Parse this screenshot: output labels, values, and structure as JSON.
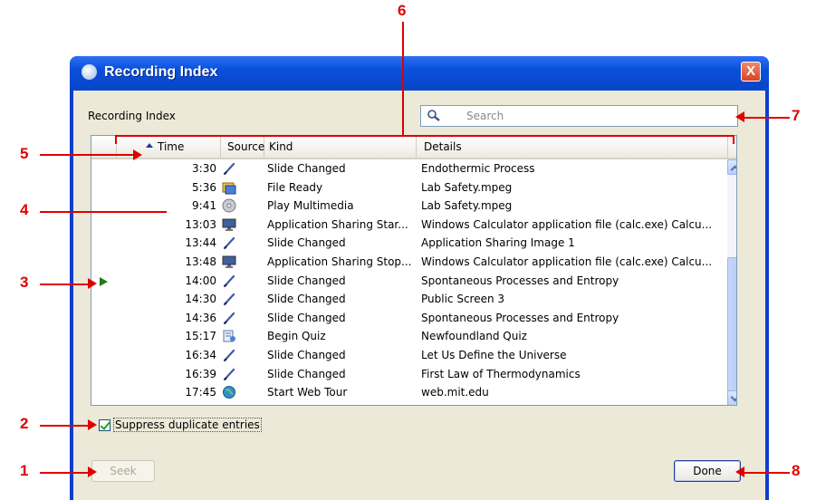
{
  "window": {
    "title": "Recording Index",
    "close_label": "X"
  },
  "index_label": "Recording Index",
  "search": {
    "placeholder": "Search"
  },
  "columns": {
    "time": "Time",
    "source": "Source",
    "kind": "Kind",
    "details": "Details"
  },
  "rows": [
    {
      "time": "3:30",
      "source": "pencil-icon",
      "kind": "Slide Changed",
      "details": "Endothermic Process"
    },
    {
      "time": "5:36",
      "source": "file-ready-icon",
      "kind": "File Ready",
      "details": "Lab Safety.mpeg"
    },
    {
      "time": "9:41",
      "source": "disc-icon",
      "kind": "Play Multimedia",
      "details": "Lab Safety.mpeg"
    },
    {
      "time": "13:03",
      "source": "monitor-icon",
      "kind": "Application Sharing Star...",
      "details": "Windows Calculator application file (calc.exe) Calcu..."
    },
    {
      "time": "13:44",
      "source": "pencil-icon",
      "kind": "Slide Changed",
      "details": "Application Sharing Image 1"
    },
    {
      "time": "13:48",
      "source": "monitor-icon",
      "kind": "Application Sharing Stop...",
      "details": "Windows Calculator application file (calc.exe) Calcu..."
    },
    {
      "time": "14:00",
      "source": "pencil-icon",
      "kind": "Slide Changed",
      "details": "Spontaneous Processes and Entropy",
      "current": true
    },
    {
      "time": "14:30",
      "source": "pencil-icon",
      "kind": "Slide Changed",
      "details": "Public Screen 3"
    },
    {
      "time": "14:36",
      "source": "pencil-icon",
      "kind": "Slide Changed",
      "details": "Spontaneous Processes and Entropy"
    },
    {
      "time": "15:17",
      "source": "quiz-icon",
      "kind": "Begin Quiz",
      "details": "Newfoundland Quiz"
    },
    {
      "time": "16:34",
      "source": "pencil-icon",
      "kind": "Slide Changed",
      "details": "Let Us Define the Universe"
    },
    {
      "time": "16:39",
      "source": "pencil-icon",
      "kind": "Slide Changed",
      "details": "First Law of Thermodynamics"
    },
    {
      "time": "17:45",
      "source": "globe-icon",
      "kind": "Start Web Tour",
      "details": "web.mit.edu"
    }
  ],
  "suppress": {
    "label": "Suppress duplicate entries",
    "checked": true
  },
  "buttons": {
    "seek": "Seek",
    "done": "Done"
  },
  "callouts": [
    "1",
    "2",
    "3",
    "4",
    "5",
    "6",
    "7",
    "8"
  ],
  "colors": {
    "callout": "#e00000",
    "titlebar": "#0b4fd9",
    "client": "#ece9d8"
  }
}
